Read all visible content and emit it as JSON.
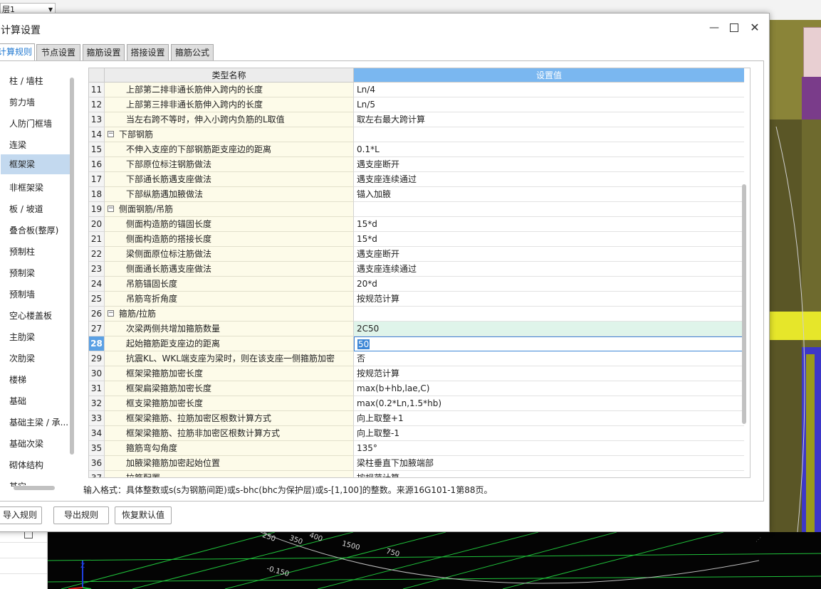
{
  "background": {
    "combo_value": "层1"
  },
  "dialog": {
    "title": "计算设置",
    "window_buttons": {
      "minimize": "—",
      "maximize": "□",
      "close": "✕"
    },
    "tabs": [
      {
        "label": "计算规则",
        "active": true
      },
      {
        "label": "节点设置",
        "active": false
      },
      {
        "label": "箍筋设置",
        "active": false
      },
      {
        "label": "搭接设置",
        "active": false
      },
      {
        "label": "箍筋公式",
        "active": false
      }
    ],
    "categories": [
      "柱 / 墙柱",
      "剪力墙",
      "人防门框墙",
      "连梁",
      "框架梁",
      "非框架梁",
      "板 / 坡道",
      "叠合板(整厚)",
      "预制柱",
      "预制梁",
      "预制墙",
      "空心楼盖板",
      "主肋梁",
      "次肋梁",
      "楼梯",
      "基础",
      "基础主梁 / 承...",
      "基础次梁",
      "砌体结构",
      "其它"
    ],
    "selected_category": "框架梁",
    "grid": {
      "headers": {
        "name": "类型名称",
        "value": "设置值"
      },
      "rows": [
        {
          "num": "11",
          "name": "上部第二排非通长筋伸入跨内的长度",
          "value": "Ln/4",
          "kind": "child"
        },
        {
          "num": "12",
          "name": "上部第三排非通长筋伸入跨内的长度",
          "value": "Ln/5",
          "kind": "child"
        },
        {
          "num": "13",
          "name": "当左右跨不等时，伸入小跨内负筋的L取值",
          "value": "取左右最大跨计算",
          "kind": "child"
        },
        {
          "num": "14",
          "name": "下部钢筋",
          "value": "",
          "kind": "group"
        },
        {
          "num": "15",
          "name": "不伸入支座的下部钢筋距支座边的距离",
          "value": "0.1*L",
          "kind": "child"
        },
        {
          "num": "16",
          "name": "下部原位标注钢筋做法",
          "value": "遇支座断开",
          "kind": "child"
        },
        {
          "num": "17",
          "name": "下部通长筋遇支座做法",
          "value": "遇支座连续通过",
          "kind": "child"
        },
        {
          "num": "18",
          "name": "下部纵筋遇加腋做法",
          "value": "锚入加腋",
          "kind": "child"
        },
        {
          "num": "19",
          "name": "侧面钢筋/吊筋",
          "value": "",
          "kind": "group"
        },
        {
          "num": "20",
          "name": "侧面构造筋的锚固长度",
          "value": "15*d",
          "kind": "child"
        },
        {
          "num": "21",
          "name": "侧面构造筋的搭接长度",
          "value": "15*d",
          "kind": "child"
        },
        {
          "num": "22",
          "name": "梁侧面原位标注筋做法",
          "value": "遇支座断开",
          "kind": "child"
        },
        {
          "num": "23",
          "name": "侧面通长筋遇支座做法",
          "value": "遇支座连续通过",
          "kind": "child"
        },
        {
          "num": "24",
          "name": "吊筋锚固长度",
          "value": "20*d",
          "kind": "child"
        },
        {
          "num": "25",
          "name": "吊筋弯折角度",
          "value": "按规范计算",
          "kind": "child"
        },
        {
          "num": "26",
          "name": "箍筋/拉筋",
          "value": "",
          "kind": "group"
        },
        {
          "num": "27",
          "name": "次梁两侧共增加箍筋数量",
          "value": "2C50",
          "kind": "child",
          "state": "highlight"
        },
        {
          "num": "28",
          "name": "起始箍筋距支座边的距离",
          "value": "50",
          "kind": "child",
          "state": "editing"
        },
        {
          "num": "29",
          "name": "抗震KL、WKL端支座为梁时，则在该支座一侧箍筋加密",
          "value": "否",
          "kind": "child"
        },
        {
          "num": "30",
          "name": "框架梁箍筋加密长度",
          "value": "按规范计算",
          "kind": "child"
        },
        {
          "num": "31",
          "name": "框架扁梁箍筋加密长度",
          "value": "max(b+hb,lae,C)",
          "kind": "child"
        },
        {
          "num": "32",
          "name": "框支梁箍筋加密长度",
          "value": "max(0.2*Ln,1.5*hb)",
          "kind": "child"
        },
        {
          "num": "33",
          "name": "框架梁箍筋、拉筋加密区根数计算方式",
          "value": "向上取整+1",
          "kind": "child"
        },
        {
          "num": "34",
          "name": "框架梁箍筋、拉筋非加密区根数计算方式",
          "value": "向上取整-1",
          "kind": "child"
        },
        {
          "num": "35",
          "name": "箍筋弯勾角度",
          "value": "135°",
          "kind": "child"
        },
        {
          "num": "36",
          "name": "加腋梁箍筋加密起始位置",
          "value": "梁柱垂直下加腋端部",
          "kind": "child"
        },
        {
          "num": "37",
          "name": "拉筋配置",
          "value": "按规范计算",
          "kind": "child"
        }
      ]
    },
    "hint": "输入格式：具体整数或s(s为钢筋间距)或s-bhc(bhc为保护层)或s-[1,100]的整数。来源16G101-1第88页。",
    "buttons": {
      "import": "导入规则",
      "export": "导出规则",
      "restore": "恢复默认值"
    }
  },
  "viewport": {
    "dimension_labels": [
      "250",
      "350",
      "400",
      "1500",
      "750",
      "-0.150"
    ]
  },
  "colors": {
    "header_value_bg": "#7ab7f0",
    "name_col_bg": "#fdfbe9",
    "selected_category_bg": "#c3d9ef",
    "highlight_row_bg": "#dff4ea",
    "active_tab_text": "#1f78d1"
  }
}
